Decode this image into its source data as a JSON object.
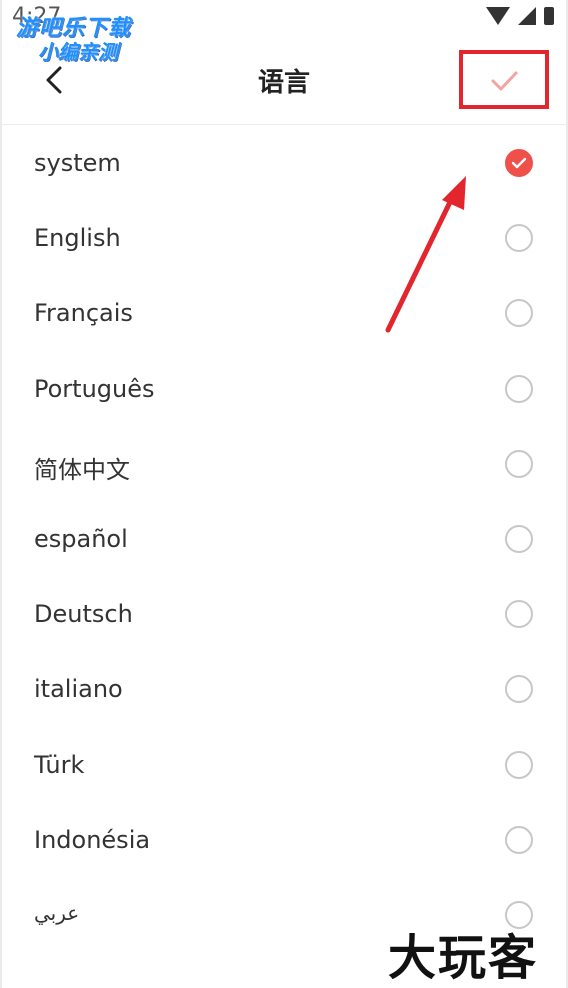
{
  "status_bar": {
    "time": "4:27"
  },
  "watermark_top": {
    "line1": "游吧乐下载",
    "line2": "小编亲测"
  },
  "header": {
    "title": "语言",
    "back_icon": "chevron-left-icon",
    "confirm_icon": "check-icon"
  },
  "languages": [
    {
      "label": "system",
      "selected": true
    },
    {
      "label": "English",
      "selected": false
    },
    {
      "label": "Français",
      "selected": false
    },
    {
      "label": "Português",
      "selected": false
    },
    {
      "label": "简体中文",
      "selected": false
    },
    {
      "label": "español",
      "selected": false
    },
    {
      "label": "Deutsch",
      "selected": false
    },
    {
      "label": "italiano",
      "selected": false
    },
    {
      "label": "Türk",
      "selected": false
    },
    {
      "label": "Indonésia",
      "selected": false
    },
    {
      "label": "عربي",
      "selected": false
    }
  ],
  "watermark_bottom": {
    "text": "大玩客"
  },
  "colors": {
    "accent": "#f0504a",
    "highlight_box": "#e3262d",
    "arrow": "#e3262d"
  }
}
